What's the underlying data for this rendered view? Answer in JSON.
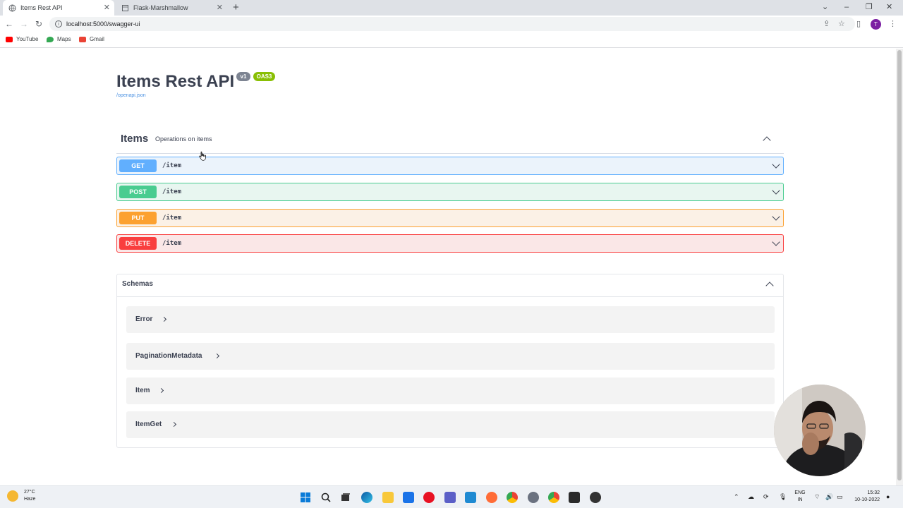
{
  "browser": {
    "tabs": [
      {
        "label": "Items Rest API",
        "active": true
      },
      {
        "label": "Flask-Marshmallow",
        "active": false
      }
    ],
    "url": "localhost:5000/swagger-ui",
    "bookmarks": [
      {
        "label": "YouTube",
        "color": "#ff0000"
      },
      {
        "label": "Maps",
        "color": "#34a853"
      },
      {
        "label": "Gmail",
        "color": "#ea4335"
      }
    ],
    "profile_initial": "T"
  },
  "api": {
    "title": "Items Rest API",
    "version_badge": "v1",
    "oas_badge": "OAS3",
    "spec_link": "/openapi.json"
  },
  "tag": {
    "name": "Items",
    "description": "Operations on items"
  },
  "operations": [
    {
      "method": "GET",
      "path": "/item",
      "color": "#61affe",
      "bg": "#ebf3fb"
    },
    {
      "method": "POST",
      "path": "/item",
      "color": "#49cc90",
      "bg": "#e8f6f0"
    },
    {
      "method": "PUT",
      "path": "/item",
      "color": "#fca130",
      "bg": "#fbf1e6"
    },
    {
      "method": "DELETE",
      "path": "/item",
      "color": "#f93e3e",
      "bg": "#fae7e7"
    }
  ],
  "schemas": {
    "title": "Schemas",
    "models": [
      "Error",
      "PaginationMetadata",
      "Item",
      "ItemGet"
    ]
  },
  "taskbar": {
    "temperature": "27°C",
    "weather": "Haze",
    "language": "ENG",
    "region": "IN",
    "time": "15:32",
    "date": "10-10-2022"
  }
}
